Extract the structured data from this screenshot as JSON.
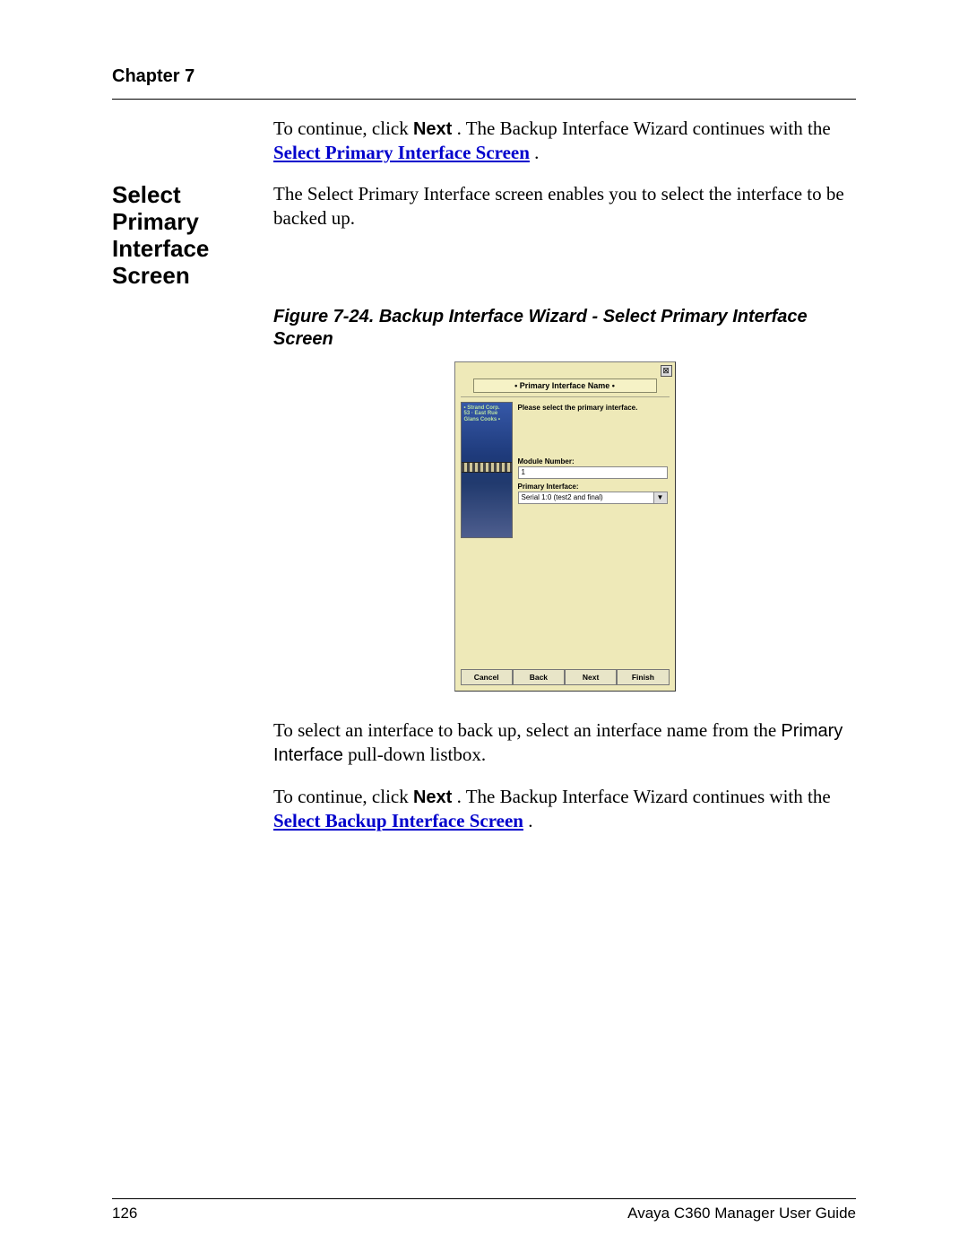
{
  "header": {
    "chapter": "Chapter 7"
  },
  "intro_para": {
    "pre": "To continue, click ",
    "bold": "Next",
    "mid": ". The Backup Interface Wizard continues with the ",
    "link": "Select Primary Interface Screen",
    "post": "."
  },
  "margin_heading": "Select Primary Interface Screen",
  "lead_para": "The Select Primary Interface screen enables you to select the interface to be backed up.",
  "figure_caption": "Figure 7-24. Backup Interface Wizard - Select Primary Interface Screen",
  "wizard": {
    "close_glyph": "⊠",
    "title": "• Primary Interface Name •",
    "instruction": "Please select the primary interface.",
    "sidebar_lines": [
      "• Strand Corp.",
      "53 · East Rue",
      "Glans Cooks •"
    ],
    "mod_label": "Module Number:",
    "mod_value": "1",
    "pi_label": "Primary Interface:",
    "pi_value": "Serial 1:0 (test2 and final)",
    "dropdown_glyph": "▼",
    "buttons": {
      "cancel": "Cancel",
      "back": "Back",
      "next": "Next",
      "finish": "Finish"
    }
  },
  "post_fig_para": {
    "pre": "To select an interface to back up, select an interface name from the ",
    "sans": "Primary Interface",
    "post": " pull-down listbox."
  },
  "continue_para": {
    "pre": "To continue, click ",
    "bold": "Next",
    "mid": ". The Backup Interface Wizard continues with the ",
    "link": "Select Backup Interface Screen",
    "post": "."
  },
  "footer": {
    "page_num": "126",
    "doc_title": "Avaya C360 Manager User Guide"
  }
}
